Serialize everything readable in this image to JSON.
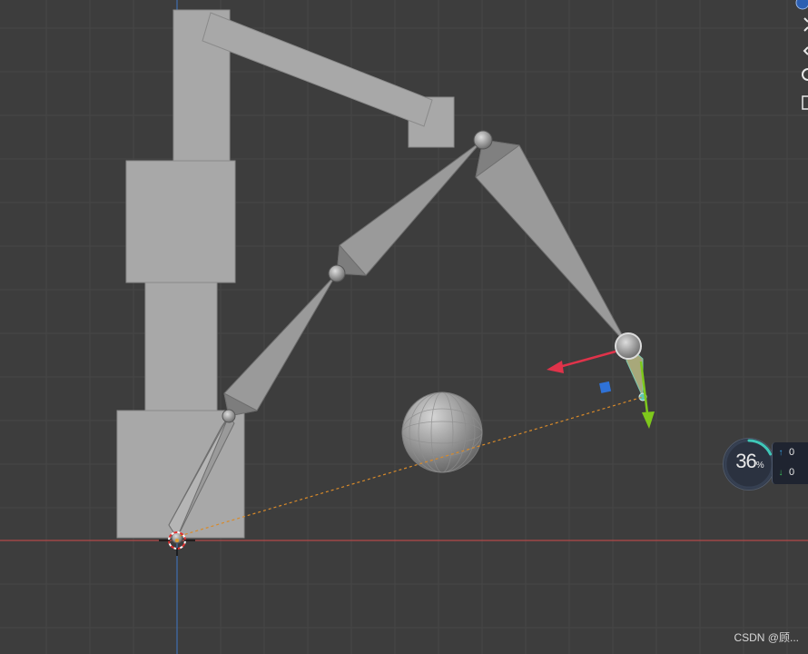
{
  "app": {
    "context": "3D viewport - armature bones with gizmo"
  },
  "overlay_widget": {
    "percent_value": "36",
    "percent_unit": "%",
    "upload_value": "0",
    "download_value": "0"
  },
  "watermark": {
    "text": "CSDN @顾..."
  },
  "colors": {
    "background": "#3d3d3d",
    "grid_line": "#474747",
    "x_axis": "#b34848",
    "y_axis": "#3f6db0",
    "bone_fill": "#9a9a9a",
    "mesh_fill": "#a8a8a8",
    "gizmo_x": "#e0334a",
    "gizmo_y": "#7ec81c",
    "gizmo_plane": "#2f72d6",
    "ik_dashed": "#d88a2a"
  },
  "icons": [
    "gizmo-x-arrow-icon",
    "gizmo-y-arrow-icon",
    "gizmo-plane-handle-icon",
    "3d-cursor-icon"
  ]
}
